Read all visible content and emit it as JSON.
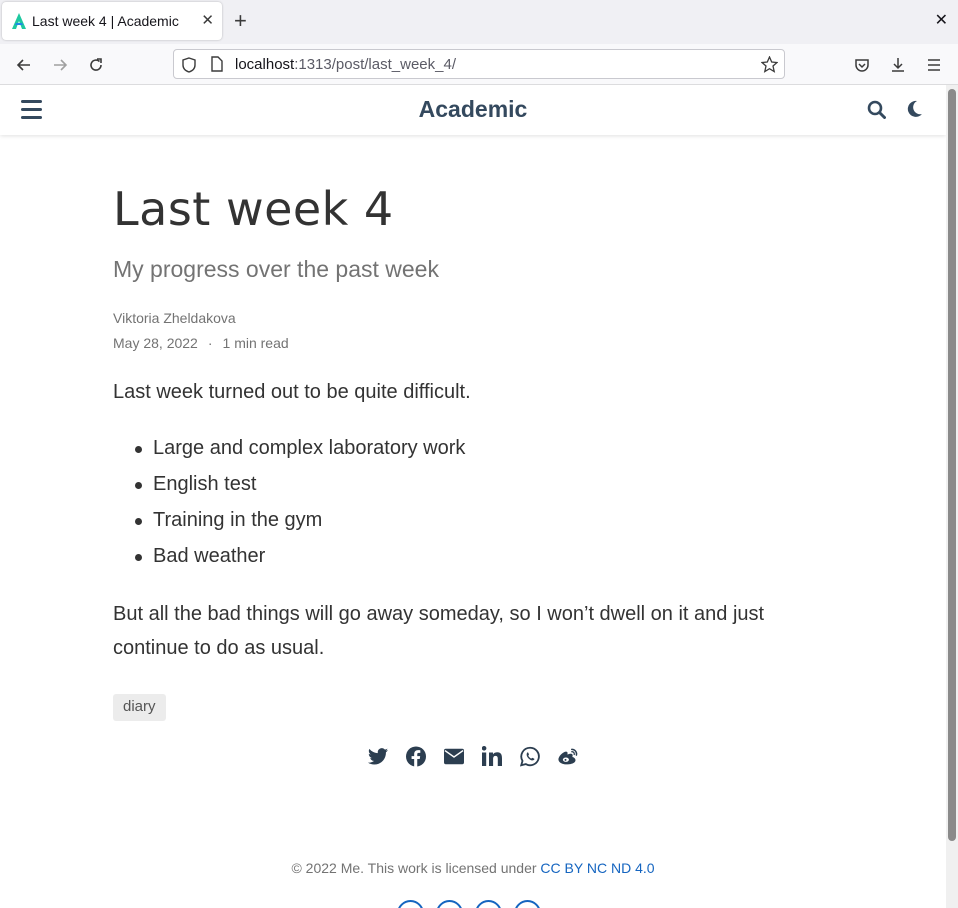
{
  "browser": {
    "tab_title": "Last week 4 | Academic",
    "tab_close": "✕",
    "new_tab": "+",
    "window_close": "✕",
    "url_host": "localhost",
    "url_rest": ":1313/post/last_week_4/"
  },
  "site": {
    "brand": "Academic"
  },
  "post": {
    "title": "Last week 4",
    "subtitle": "My progress over the past week",
    "author": "Viktoria Zheldakova",
    "date": "May 28, 2022",
    "separator": "·",
    "read_time": "1 min read",
    "intro": "Last week turned out to be quite difficult.",
    "list": [
      "Large and complex laboratory work",
      "English test",
      "Training in the gym",
      "Bad weather"
    ],
    "closing": "But all the bad things will go away someday, so I won’t dwell on it and just continue to do as usual.",
    "tag": "diary"
  },
  "share": {
    "icons": [
      "twitter-icon",
      "facebook-icon",
      "email-icon",
      "linkedin-icon",
      "whatsapp-icon",
      "weibo-icon"
    ],
    "color": "#2c3e50"
  },
  "footer": {
    "text": "© 2022 Me. This work is licensed under ",
    "license": "CC BY NC ND 4.0"
  },
  "colors": {
    "link": "#1565c0",
    "brand": "#34495e"
  }
}
